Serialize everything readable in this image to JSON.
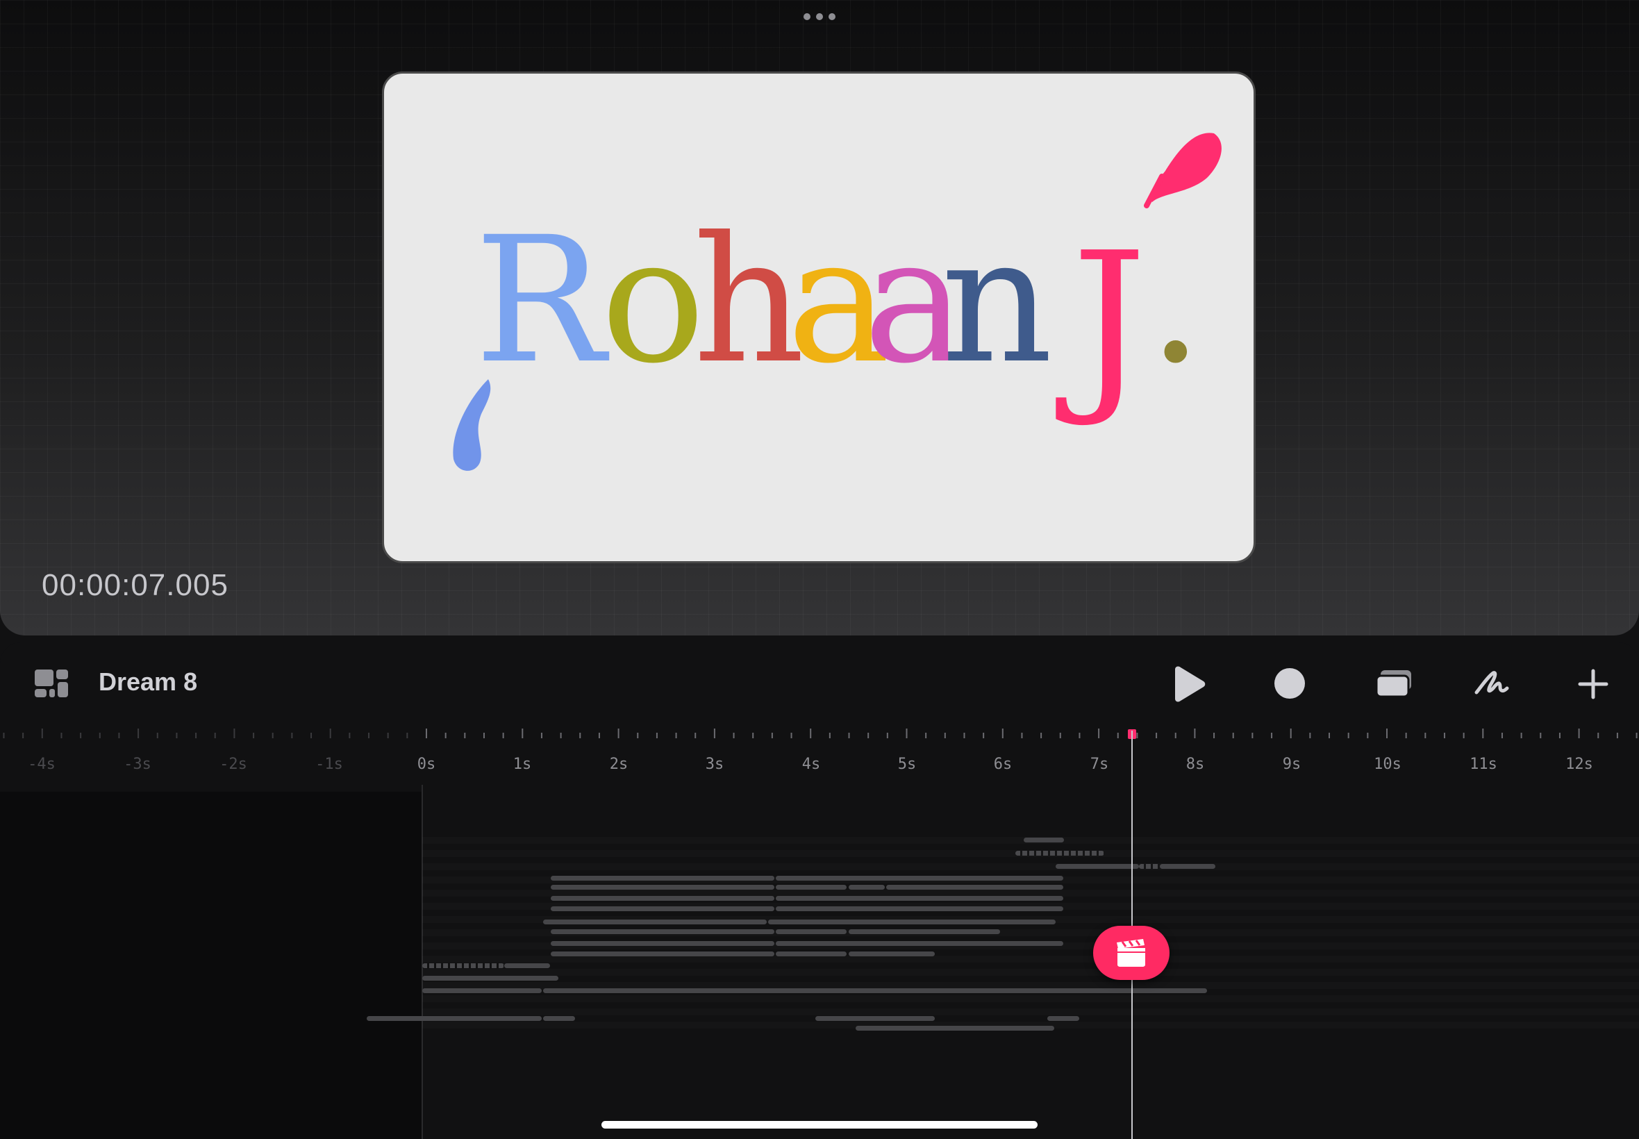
{
  "canvas": {
    "timecode": "00:00:07.005",
    "artwork": {
      "text_letters": [
        {
          "char": "R",
          "color": "#7ba4f0"
        },
        {
          "char": "o",
          "color": "#a8a81c"
        },
        {
          "char": "h",
          "color": "#d04c45"
        },
        {
          "char": "a",
          "color": "#f0b213"
        },
        {
          "char": "a",
          "color": "#d355b7"
        },
        {
          "char": "n",
          "color": "#3f5b8c"
        },
        {
          "char": "J",
          "color": "#ff2d6f"
        },
        {
          "char": ".",
          "color": "#8f8534"
        }
      ]
    }
  },
  "toolbar": {
    "document_title": "Dream 8",
    "icons": [
      "layout-icon",
      "play-icon",
      "record-icon",
      "layers-icon",
      "draw-icon",
      "add-icon"
    ]
  },
  "timeline": {
    "tick_labels": [
      "-4s",
      "-3s",
      "-2s",
      "-1s",
      "0s",
      "1s",
      "2s",
      "3s",
      "4s",
      "5s",
      "6s",
      "7s",
      "8s",
      "9s",
      "10s",
      "11s",
      "12s"
    ],
    "playhead_seconds": 7.005
  },
  "colors": {
    "accent": "#ff2a63",
    "background": "#111112"
  }
}
